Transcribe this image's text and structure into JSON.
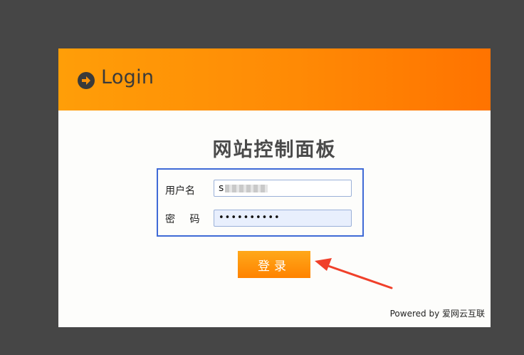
{
  "header": {
    "title": "Login",
    "icon": "arrow-right-circle-icon"
  },
  "panel": {
    "title": "网站控制面板"
  },
  "form": {
    "username_label": "用户名",
    "username_value": "s",
    "password_label": "密 码",
    "password_value": "••••••••••"
  },
  "login_button": {
    "label": "登录"
  },
  "footer": {
    "text": "Powered by 爱网云互联"
  },
  "colors": {
    "background": "#464646",
    "header_orange": "#ff8a05",
    "button_orange": "#ff9310",
    "form_border": "#3f6ad6",
    "annotation_arrow": "#f0402a"
  }
}
